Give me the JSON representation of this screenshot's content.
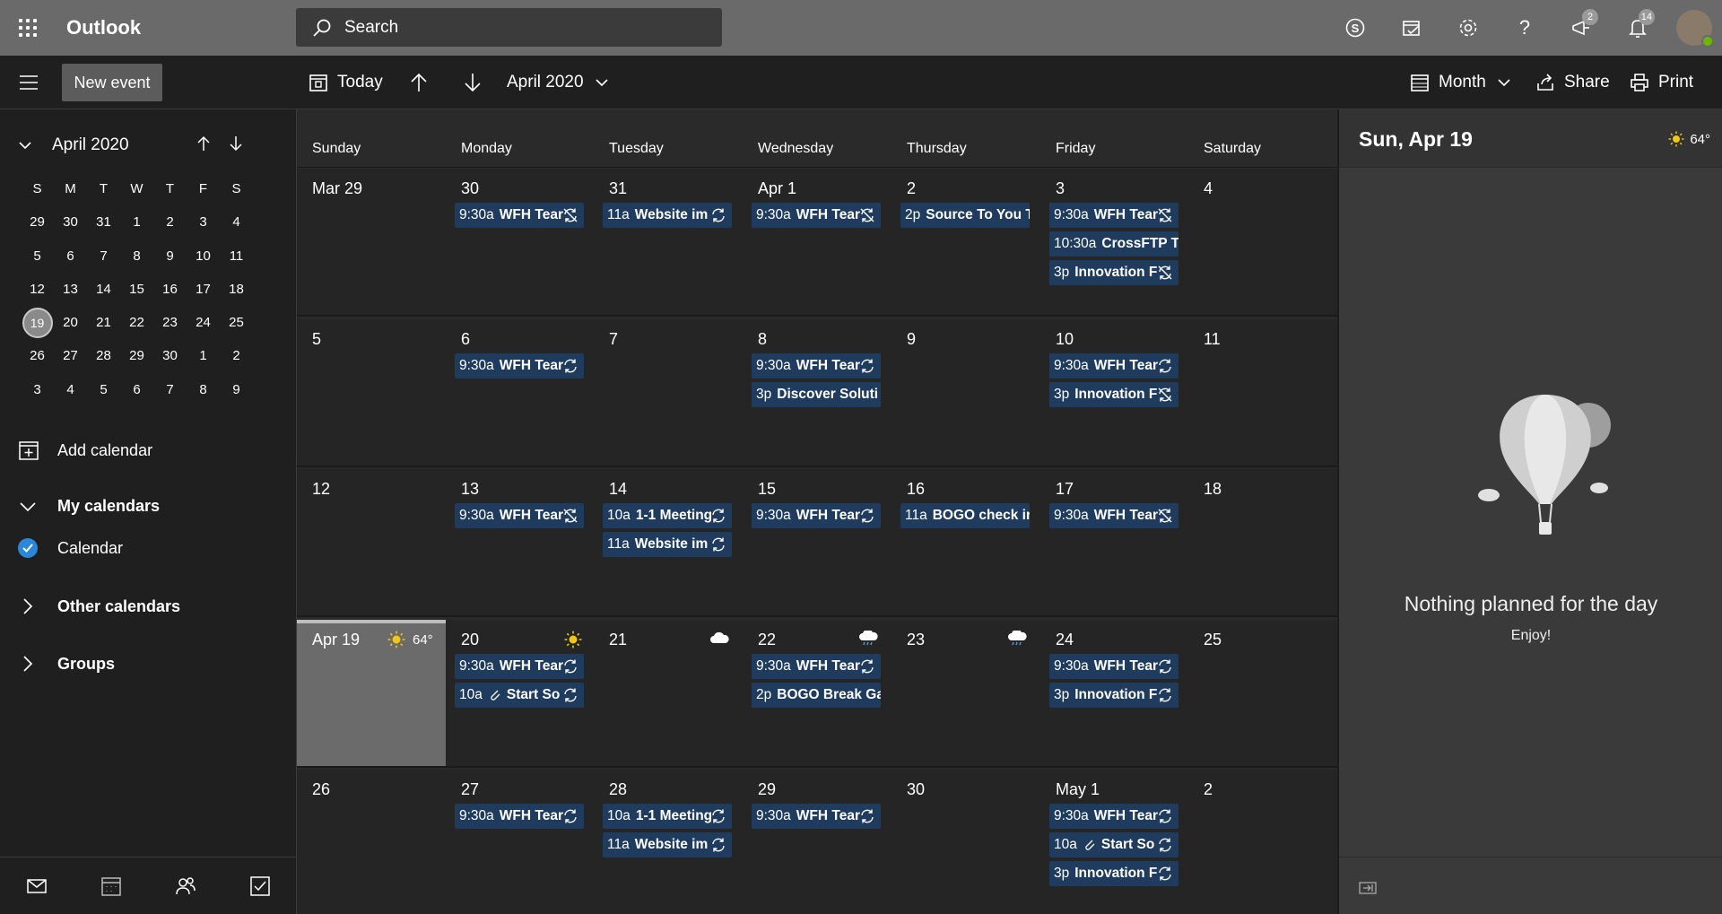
{
  "app": {
    "title": "Outlook"
  },
  "search": {
    "placeholder": "Search"
  },
  "topbar": {
    "skype_icon": "skype-icon",
    "badges": {
      "feedback": "2",
      "notifications": "14"
    }
  },
  "toolbar": {
    "new_event": "New event",
    "today": "Today",
    "month_label": "April 2020",
    "view": "Month",
    "share": "Share",
    "print": "Print"
  },
  "mini_calendar": {
    "title": "April 2020",
    "weekdays": [
      "S",
      "M",
      "T",
      "W",
      "T",
      "F",
      "S"
    ],
    "weeks": [
      [
        "29",
        "30",
        "31",
        "1",
        "2",
        "3",
        "4"
      ],
      [
        "5",
        "6",
        "7",
        "8",
        "9",
        "10",
        "11"
      ],
      [
        "12",
        "13",
        "14",
        "15",
        "16",
        "17",
        "18"
      ],
      [
        "19",
        "20",
        "21",
        "22",
        "23",
        "24",
        "25"
      ],
      [
        "26",
        "27",
        "28",
        "29",
        "30",
        "1",
        "2"
      ],
      [
        "3",
        "4",
        "5",
        "6",
        "7",
        "8",
        "9"
      ]
    ],
    "selected": "19"
  },
  "sidebar": {
    "add_calendar": "Add calendar",
    "my_calendars": "My calendars",
    "calendar": "Calendar",
    "other_calendars": "Other calendars",
    "groups": "Groups"
  },
  "month_grid": {
    "weekdays": [
      "Sunday",
      "Monday",
      "Tuesday",
      "Wednesday",
      "Thursday",
      "Friday",
      "Saturday"
    ],
    "weeks": [
      {
        "days": [
          {
            "label": "Mar 29",
            "events": []
          },
          {
            "label": "30",
            "events": [
              {
                "time": "9:30a",
                "title": "WFH Tear",
                "icon": "sync-off"
              }
            ]
          },
          {
            "label": "31",
            "events": [
              {
                "time": "11a",
                "title": "Website im",
                "icon": "sync"
              }
            ]
          },
          {
            "label": "Apr 1",
            "events": [
              {
                "time": "9:30a",
                "title": "WFH Tear",
                "icon": "sync-off"
              }
            ]
          },
          {
            "label": "2",
            "events": [
              {
                "time": "2p",
                "title": "Source To You T",
                "icon": ""
              }
            ]
          },
          {
            "label": "3",
            "events": [
              {
                "time": "9:30a",
                "title": "WFH Tear",
                "icon": "sync-off"
              },
              {
                "time": "10:30a",
                "title": "CrossFTP Tr",
                "icon": ""
              },
              {
                "time": "3p",
                "title": "Innovation F",
                "icon": "sync-off"
              }
            ]
          },
          {
            "label": "4",
            "events": []
          }
        ]
      },
      {
        "days": [
          {
            "label": "5",
            "events": []
          },
          {
            "label": "6",
            "events": [
              {
                "time": "9:30a",
                "title": "WFH Tear",
                "icon": "sync"
              }
            ]
          },
          {
            "label": "7",
            "events": []
          },
          {
            "label": "8",
            "events": [
              {
                "time": "9:30a",
                "title": "WFH Tear",
                "icon": "sync"
              },
              {
                "time": "3p",
                "title": "Discover Soluti",
                "icon": ""
              }
            ]
          },
          {
            "label": "9",
            "events": []
          },
          {
            "label": "10",
            "events": [
              {
                "time": "9:30a",
                "title": "WFH Tear",
                "icon": "sync"
              },
              {
                "time": "3p",
                "title": "Innovation F",
                "icon": "sync-off"
              }
            ]
          },
          {
            "label": "11",
            "events": []
          }
        ]
      },
      {
        "days": [
          {
            "label": "12",
            "events": []
          },
          {
            "label": "13",
            "events": [
              {
                "time": "9:30a",
                "title": "WFH Tear",
                "icon": "sync-off"
              }
            ]
          },
          {
            "label": "14",
            "events": [
              {
                "time": "10a",
                "title": "1-1 Meeting",
                "icon": "sync"
              },
              {
                "time": "11a",
                "title": "Website im",
                "icon": "sync"
              }
            ]
          },
          {
            "label": "15",
            "events": [
              {
                "time": "9:30a",
                "title": "WFH Tear",
                "icon": "sync"
              }
            ]
          },
          {
            "label": "16",
            "events": [
              {
                "time": "11a",
                "title": "BOGO check ir",
                "icon": ""
              }
            ]
          },
          {
            "label": "17",
            "events": [
              {
                "time": "9:30a",
                "title": "WFH Tear",
                "icon": "sync-off"
              }
            ]
          },
          {
            "label": "18",
            "events": []
          }
        ]
      },
      {
        "days": [
          {
            "label": "Apr 19",
            "today": true,
            "weather": {
              "icon": "sun-icon",
              "temp": "64°"
            },
            "events": []
          },
          {
            "label": "20",
            "weather": {
              "icon": "sun-icon"
            },
            "events": [
              {
                "time": "9:30a",
                "title": "WFH Tear",
                "icon": "sync"
              },
              {
                "time": "10a",
                "title": "Start So",
                "icon": "sync",
                "attach": true
              }
            ]
          },
          {
            "label": "21",
            "weather": {
              "icon": "cloud-icon"
            },
            "events": []
          },
          {
            "label": "22",
            "weather": {
              "icon": "rain-cloud-icon"
            },
            "events": [
              {
                "time": "9:30a",
                "title": "WFH Tear",
                "icon": "sync"
              },
              {
                "time": "2p",
                "title": "BOGO Break Ga",
                "icon": ""
              }
            ]
          },
          {
            "label": "23",
            "weather": {
              "icon": "rain-cloud-icon"
            },
            "events": []
          },
          {
            "label": "24",
            "events": [
              {
                "time": "9:30a",
                "title": "WFH Tear",
                "icon": "sync"
              },
              {
                "time": "3p",
                "title": "Innovation F",
                "icon": "sync"
              }
            ]
          },
          {
            "label": "25",
            "events": []
          }
        ]
      },
      {
        "days": [
          {
            "label": "26",
            "events": []
          },
          {
            "label": "27",
            "events": [
              {
                "time": "9:30a",
                "title": "WFH Tear",
                "icon": "sync"
              }
            ]
          },
          {
            "label": "28",
            "events": [
              {
                "time": "10a",
                "title": "1-1 Meeting",
                "icon": "sync"
              },
              {
                "time": "11a",
                "title": "Website im",
                "icon": "sync"
              }
            ]
          },
          {
            "label": "29",
            "events": [
              {
                "time": "9:30a",
                "title": "WFH Tear",
                "icon": "sync"
              }
            ]
          },
          {
            "label": "30",
            "events": []
          },
          {
            "label": "May 1",
            "events": [
              {
                "time": "9:30a",
                "title": "WFH Tear",
                "icon": "sync"
              },
              {
                "time": "10a",
                "title": "Start So",
                "icon": "sync",
                "attach": true
              },
              {
                "time": "3p",
                "title": "Innovation F",
                "icon": "sync"
              }
            ]
          },
          {
            "label": "2",
            "events": []
          }
        ]
      }
    ]
  },
  "day_pane": {
    "date": "Sun, Apr 19",
    "temp": "64°",
    "empty_title": "Nothing planned for the day",
    "empty_subtitle": "Enjoy!"
  },
  "colors": {
    "event_bg": "#1f3c5e",
    "accent": "#2b88d8",
    "topbar": "#6a6a6a"
  }
}
